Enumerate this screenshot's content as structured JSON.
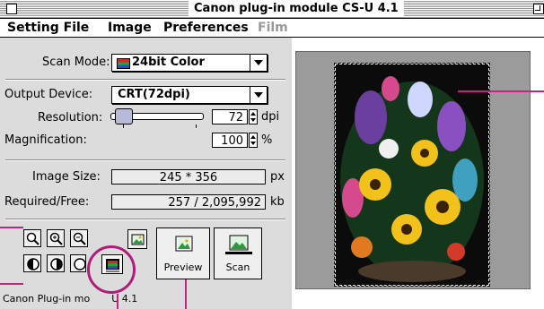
{
  "window": {
    "title": "Canon plug-in module CS-U 4.1"
  },
  "menubar": {
    "items": [
      {
        "label": "Setting File",
        "enabled": true
      },
      {
        "label": "Image",
        "enabled": true
      },
      {
        "label": "Preferences",
        "enabled": true
      },
      {
        "label": "Film",
        "enabled": false
      }
    ]
  },
  "scan_mode": {
    "label": "Scan Mode:",
    "value": "24bit Color"
  },
  "output_device": {
    "label": "Output Device:",
    "value": "CRT(72dpi)"
  },
  "resolution": {
    "label": "Resolution:",
    "value": "72",
    "unit": "dpi"
  },
  "magnification": {
    "label": "Magnification:",
    "value": "100",
    "unit": "%"
  },
  "image_size": {
    "label": "Image Size:",
    "value": "245 * 356",
    "unit": "px"
  },
  "required_free": {
    "label": "Required/Free:",
    "value": "257 / 2,095,992",
    "unit": "kb"
  },
  "buttons": {
    "preview_label": "Preview",
    "scan_label": "Scan"
  },
  "status": {
    "text": "Canon Plug-in mo",
    "text_tail": "U 4.1"
  },
  "colors": {
    "panel": "#dcdcdc",
    "preview_bg": "#9b9b9b",
    "callout": "#c2257e"
  },
  "icons": [
    "zoom-fit-icon",
    "zoom-in-icon",
    "zoom-out-icon",
    "image-icon",
    "rotate-icon",
    "contrast-icon",
    "color-adjust-icon",
    "preview-icon",
    "scan-icon",
    "close-box-icon",
    "zoom-box-icon"
  ]
}
